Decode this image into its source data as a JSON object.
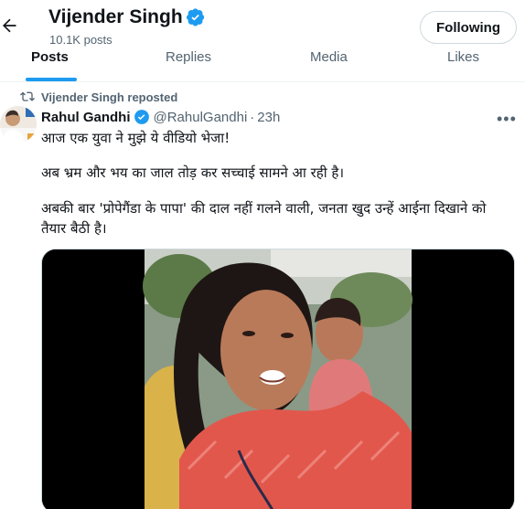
{
  "header": {
    "name": "Vijender Singh",
    "posts_count": "10.1K posts",
    "follow_label": "Following"
  },
  "tabs": [
    {
      "label": "Posts",
      "active": true
    },
    {
      "label": "Replies",
      "active": false
    },
    {
      "label": "Media",
      "active": false
    },
    {
      "label": "Likes",
      "active": false
    }
  ],
  "repost": {
    "label": "Vijender Singh reposted"
  },
  "tweet": {
    "author": "Rahul Gandhi",
    "handle": "@RahulGandhi",
    "separator": "·",
    "time": "23h",
    "more": "•••",
    "lines": [
      "आज एक युवा ने मुझे ये वीडियो भेजा!",
      "अब भ्रम और भय का जाल तोड़ कर सच्चाई सामने आ रही है।",
      "अबकी बार 'प्रोपेगैंडा के पापा' की दाल नहीं गलने वाली, जनता खुद उन्हें आईना दिखाने को तैयार बैठी है।"
    ]
  },
  "icons": {
    "back": "arrow-left-icon",
    "verified": "verified-badge-icon",
    "repost": "repost-icon",
    "more": "more-icon"
  },
  "colors": {
    "accent": "#1d9bf0",
    "muted": "#536471",
    "text": "#0f1419",
    "shirt": "#e2574c"
  }
}
